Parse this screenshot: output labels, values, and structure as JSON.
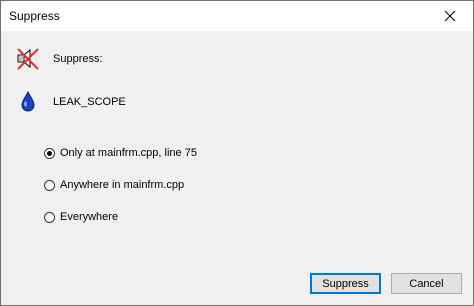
{
  "window": {
    "title": "Suppress"
  },
  "header_rows": [
    {
      "icon": "muted-speaker-icon",
      "label": "Suppress:"
    },
    {
      "icon": "water-drop-icon",
      "label": "LEAK_SCOPE"
    }
  ],
  "options": [
    {
      "label": "Only at mainfrm.cpp, line 75",
      "checked": true
    },
    {
      "label": "Anywhere in mainfrm.cpp",
      "checked": false
    },
    {
      "label": "Everywhere",
      "checked": false
    }
  ],
  "buttons": {
    "suppress": "Suppress",
    "cancel": "Cancel"
  },
  "colors": {
    "accent": "#0078d7",
    "drop": "#1a3fbf",
    "cross": "#e03030"
  }
}
